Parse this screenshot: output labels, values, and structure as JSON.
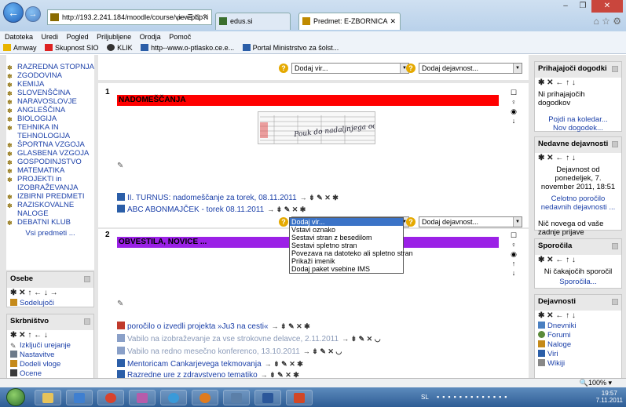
{
  "browser": {
    "address": "http://193.2.241.184/moodle/course/view.php?i",
    "address_controls": "ρ - ≣ C ✕",
    "tabs": [
      {
        "label": "edus.si"
      },
      {
        "label": "Predmet: E-ZBORNICA",
        "close": "✕"
      }
    ],
    "window_controls": {
      "minimize": "–",
      "maximize": "❐",
      "close": "✕"
    },
    "right_icons": "⌂ ☆ ⚙"
  },
  "menu": [
    "Datoteka",
    "Uredi",
    "Pogled",
    "Priljubljene",
    "Orodja",
    "Pomoč"
  ],
  "favorites": [
    "Amway",
    "Skupnost SIO",
    "KLIK",
    "http--www.o-ptlasko.ce.e...",
    "Portal Ministrstvo za šolst..."
  ],
  "left": {
    "categories": [
      "RAZREDNA STOPNJA",
      "ZGODOVINA",
      "KEMIJA",
      "SLOVENŠČINA",
      "NARAVOSLOVJE",
      "ANGLEŠČINA",
      "BIOLOGIJA",
      "TEHNIKA IN TEHNOLOGIJA",
      "ŠPORTNA VZGOJA",
      "GLASBENA VZGOJA",
      "GOSPODINJSTVO",
      "MATEMATIKA",
      "PROJEKTI in IZOBRAŽEVANJA",
      "IZBIRNI PREDMETI",
      "RAZISKOVALNE NALOGE",
      "DEBATNI KLUB"
    ],
    "all_courses": "Vsi predmeti ...",
    "people": {
      "title": "Osebe",
      "tools": "✱ ✕ ↑ ← ↓ →",
      "item": "Sodelujoči"
    },
    "admin": {
      "title": "Skrbništvo",
      "tools": "✱ ✕ ↑ ← ↓",
      "items": [
        "Izključi urejanje",
        "Nastavitve",
        "Dodeli vloge",
        "Ocene"
      ]
    }
  },
  "main": {
    "add_resource": "Dodaj vir...",
    "add_activity": "Dodaj dejavnost...",
    "section1": {
      "number": "1",
      "title": "NADOMEŠČANJA",
      "image_caption": "Pouk do nadaljnjega odpade!!",
      "resources": [
        {
          "label": "II. TURNUS: nadomeščanje za torek, 08.11.2011",
          "tools": "→ ⇟ ✎ ✕ ✱"
        },
        {
          "label": "ABC ABONMAJČEK - torek 08.11.2011",
          "tools": "→ ⇟ ✎ ✕ ✱"
        }
      ]
    },
    "section2": {
      "number": "2",
      "title": "OBVESTILA, NOVICE ...",
      "resources": [
        {
          "label": "poročilo o izvedli projekta »Ju3 na cesti«",
          "tools": "→ ⇟ ✎ ✕ ✱",
          "dim": false
        },
        {
          "label": "Vabilo na izobraževanje za vse strokovne delavce, 2.11.2011",
          "tools": "→ ⇟ ✎ ✕ ◡",
          "dim": true
        },
        {
          "label": "Vabilo na redno mesečno konferenco, 13.10.2011",
          "tools": "→ ⇟ ✎ ✕ ◡",
          "dim": true
        },
        {
          "label": "Mentoricam Cankarjevega tekmovanja",
          "tools": "→ ⇟ ✎ ✕ ✱",
          "dim": false
        },
        {
          "label": "Razredne ure z zdravstveno tematiko",
          "tools": "→ ⇟ ✎ ✕ ✱",
          "dim": false
        }
      ]
    },
    "dropdown_options": [
      "Dodaj vir...",
      "Vstavi oznako",
      "Sestavi stran z besedilom",
      "Sestavi spletno stran",
      "Povezava na datoteko ali spletno stran",
      "Prikaži imenik",
      "Dodaj paket vsebine IMS"
    ],
    "side_tools": [
      "☐",
      "♀",
      "◉",
      "↓"
    ],
    "side_tools2": [
      "☐",
      "♀",
      "◉",
      "↑",
      "↓"
    ]
  },
  "right": {
    "events": {
      "title": "Prihajajoči dogodki",
      "tools": "✱ ✕ ← ↑ ↓",
      "empty": "Ni prihajajočih dogodkov",
      "link1": "Pojdi na koledar...",
      "link2": "Nov dogodek..."
    },
    "recent": {
      "title": "Nedavne dejavnosti",
      "tools": "✱ ✕ ← ↑ ↓",
      "since": "Dejavnost od ponedeljek, 7. november 2011, 18:51",
      "report": "Celotno poročilo nedavnih dejavnosti ...",
      "nothing": "Nič novega od vaše zadnje prijave"
    },
    "news": {
      "title": "Sporočila",
      "tools": "✱ ✕ ← ↑ ↓",
      "empty": "Ni čakajočih sporočil",
      "link": "Sporočila..."
    },
    "activities": {
      "title": "Dejavnosti",
      "tools": "✱ ✕ ← ↑ ↓",
      "items": [
        "Dnevniki",
        "Forumi",
        "Naloge",
        "Viri",
        "Wikiji"
      ]
    }
  },
  "status": {
    "zoom": "100%"
  },
  "clock": {
    "time": "19:57",
    "date": "7.11.2011",
    "lang": "SL"
  }
}
